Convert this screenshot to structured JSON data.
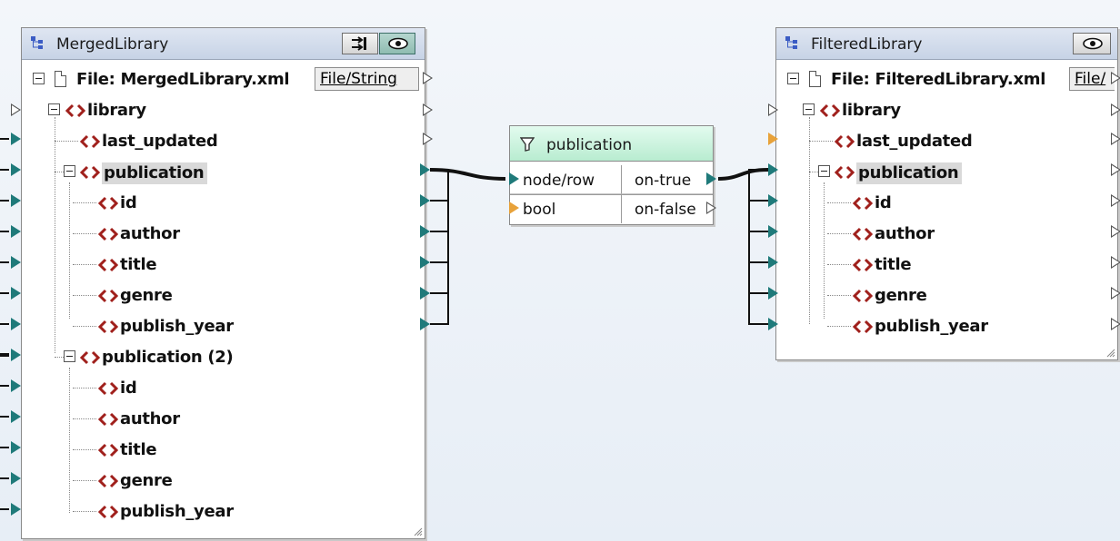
{
  "merged": {
    "title": "MergedLibrary",
    "icon": "component-tree-icon",
    "buttons": [
      "connect-toggle-icon",
      "eye-icon"
    ],
    "file_label": "File: MergedLibrary.xml",
    "file_button": "File/String",
    "root": "library",
    "items": [
      {
        "label": "last_updated"
      },
      {
        "label": "publication",
        "highlight": true
      },
      {
        "label": "id"
      },
      {
        "label": "author"
      },
      {
        "label": "title"
      },
      {
        "label": "genre"
      },
      {
        "label": "publish_year"
      },
      {
        "label": "publication (2)"
      },
      {
        "label": "id"
      },
      {
        "label": "author"
      },
      {
        "label": "title"
      },
      {
        "label": "genre"
      },
      {
        "label": "publish_year"
      }
    ]
  },
  "filter": {
    "title": "publication",
    "icon": "funnel-icon",
    "inputs": [
      "node/row",
      "bool"
    ],
    "outputs": [
      "on-true",
      "on-false"
    ]
  },
  "filtered": {
    "title": "FilteredLibrary",
    "icon": "component-tree-icon",
    "buttons": [
      "eye-icon"
    ],
    "file_label": "File: FilteredLibrary.xml",
    "file_button": "File/",
    "root": "library",
    "items": [
      {
        "label": "last_updated"
      },
      {
        "label": "publication",
        "highlight": true
      },
      {
        "label": "id"
      },
      {
        "label": "author"
      },
      {
        "label": "title"
      },
      {
        "label": "genre"
      },
      {
        "label": "publish_year"
      }
    ]
  },
  "colors": {
    "port_connected": "#1f7a7a",
    "port_required": "#e8a23a",
    "tag_icon": "#a0201c",
    "filter_header": "#b8ecd0",
    "component_header": "#c7d3e6"
  }
}
